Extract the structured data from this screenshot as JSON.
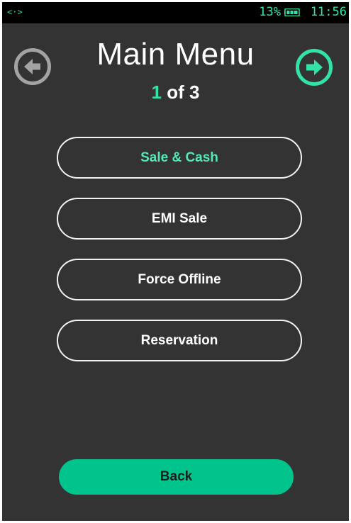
{
  "status_bar": {
    "connection_glyph": "<·>",
    "battery_percent": "13%",
    "time": "11:56",
    "icons": [
      "connection-icon",
      "battery-icon"
    ]
  },
  "header": {
    "title": "Main Menu",
    "page_current": "1",
    "page_rest": " of 3",
    "prev_icon": "arrow-left-circle-icon",
    "next_icon": "arrow-right-circle-icon"
  },
  "menu": {
    "items": [
      {
        "label": "Sale & Cash",
        "active": true
      },
      {
        "label": "EMI Sale",
        "active": false
      },
      {
        "label": "Force Offline",
        "active": false
      },
      {
        "label": "Reservation",
        "active": false
      }
    ]
  },
  "footer": {
    "back_label": "Back"
  },
  "colors": {
    "background": "#333333",
    "accent": "#33e2a9",
    "back_button": "#00c48c",
    "disabled_arrow": "#a3a3a3"
  }
}
